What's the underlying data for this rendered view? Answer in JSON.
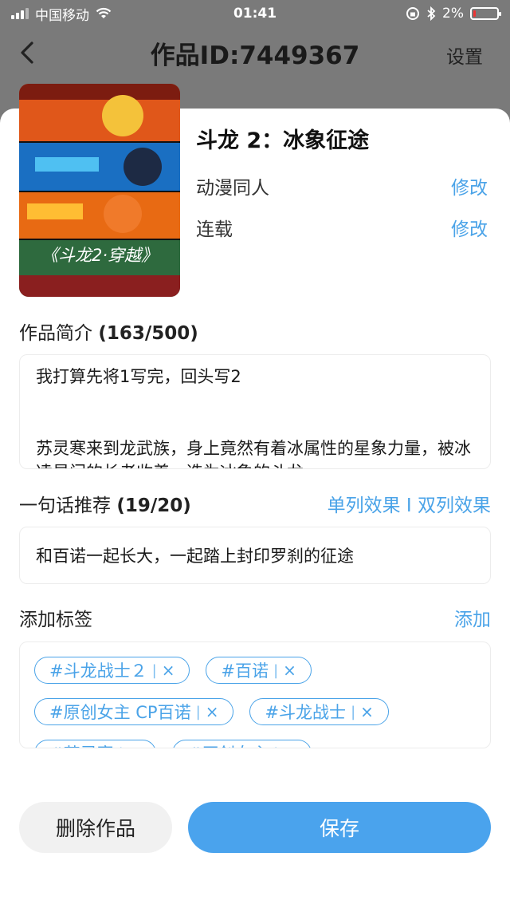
{
  "status_bar": {
    "carrier": "中国移动",
    "time": "01:41",
    "battery": "2%"
  },
  "nav": {
    "title": "作品ID:7449367",
    "settings_label": "设置"
  },
  "work": {
    "title": "斗龙 2：冰象征途",
    "category": "动漫同人",
    "category_action": "修改",
    "status": "连载",
    "status_action": "修改",
    "cover_caption": "《斗龙2·穿越》"
  },
  "intro": {
    "label": "作品简介",
    "count": "(163/500)",
    "text": "我打算先将1写完，回头写2\n\n\n苏灵寒来到龙武族，身上竟然有着冰属性的星象力量，被冰凌星门的长老收养，选为冰象的斗龙"
  },
  "recommend": {
    "label": "一句话推荐",
    "count": "(19/20)",
    "single_label": "单列效果",
    "divider": "I",
    "double_label": "双列效果",
    "text": "和百诺一起长大，一起踏上封印罗刹的征途"
  },
  "tags": {
    "label": "添加标签",
    "add_label": "添加",
    "items": [
      {
        "label": "#斗龙战士２"
      },
      {
        "label": "#百诺"
      },
      {
        "label": "#原创女主 CP百诺"
      },
      {
        "label": "#斗龙战士"
      },
      {
        "label": "#苏灵寒"
      },
      {
        "label": "#原创女主"
      }
    ],
    "sep": "|",
    "remove": "×"
  },
  "actions": {
    "delete_label": "删除作品",
    "save_label": "保存"
  },
  "colors": {
    "accent": "#4aa3ed",
    "overlay": "#7a7a7a"
  }
}
